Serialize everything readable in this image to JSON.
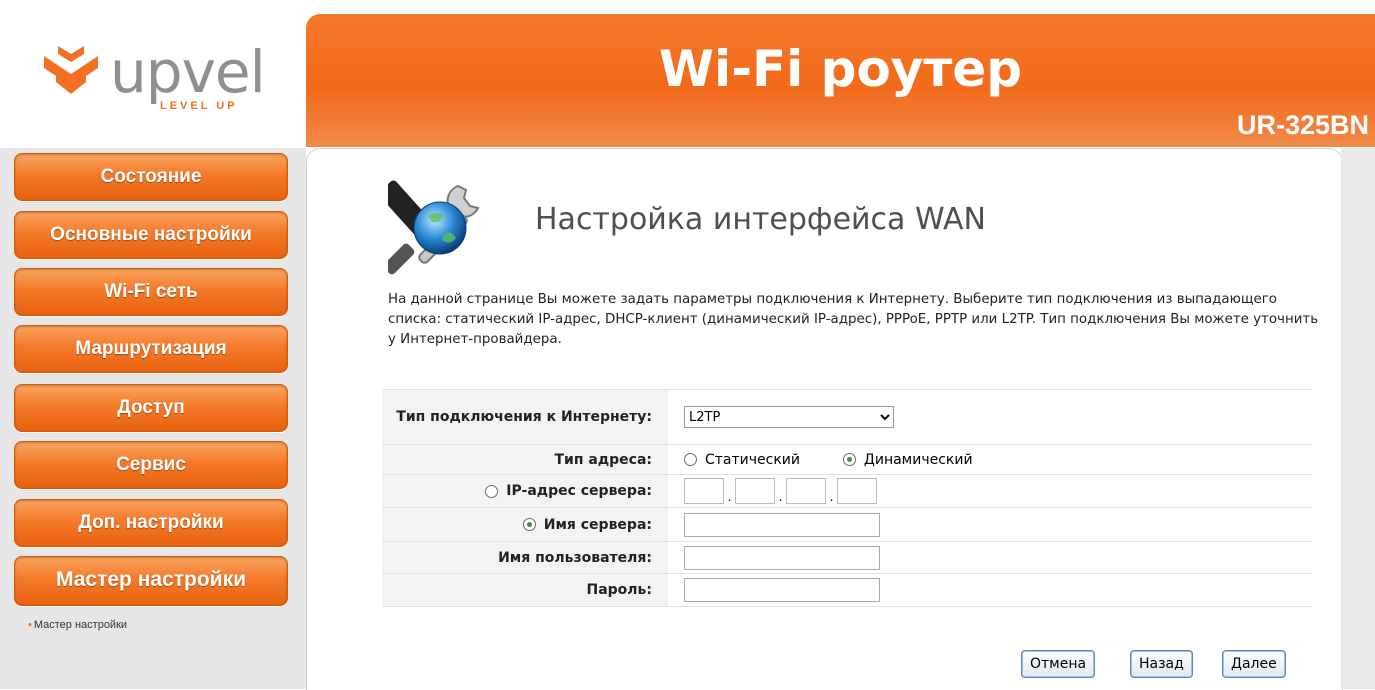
{
  "brand": {
    "name": "upvel",
    "tagline": "LEVEL UP",
    "logo_color": "#f36f21"
  },
  "header": {
    "title": "Wi-Fi роутер",
    "model": "UR-325BN",
    "color": "#f36f21"
  },
  "sidebar": {
    "items": [
      {
        "label": "Состояние"
      },
      {
        "label": "Основные настройки"
      },
      {
        "label": "Wi-Fi сеть"
      },
      {
        "label": "Маршрутизация"
      },
      {
        "label": "Доступ"
      },
      {
        "label": "Сервис"
      },
      {
        "label": "Доп. настройки"
      },
      {
        "label": "Мастер настройки"
      }
    ],
    "sub_item": "Мастер настройки"
  },
  "page": {
    "title": "Настройка интерфейса WAN",
    "icon": "tools-globe-icon",
    "description": "На данной странице Вы можете задать параметры подключения к Интернету. Выберите тип подключения из выпадающего списка: статический IP-адрес, DHCP-клиент (динамический IP-адрес), PPPoE, PPTP или L2TP. Тип подключения Вы можете уточнить у Интернет-провайдера."
  },
  "form": {
    "connection_type_label": "Тип подключения к Интернету:",
    "connection_type_value": "L2TP",
    "address_type_label": "Тип адреса:",
    "address_static": "Статический",
    "address_dynamic": "Динамический",
    "address_selected": "Динамический",
    "server_ip_label": "IP-адрес сервера:",
    "server_name_label": "Имя сервера:",
    "server_mode_selected": "server_name",
    "username_label": "Имя пользователя:",
    "password_label": "Пароль:"
  },
  "buttons": {
    "cancel": "Отмена",
    "back": "Назад",
    "next": "Далее"
  }
}
